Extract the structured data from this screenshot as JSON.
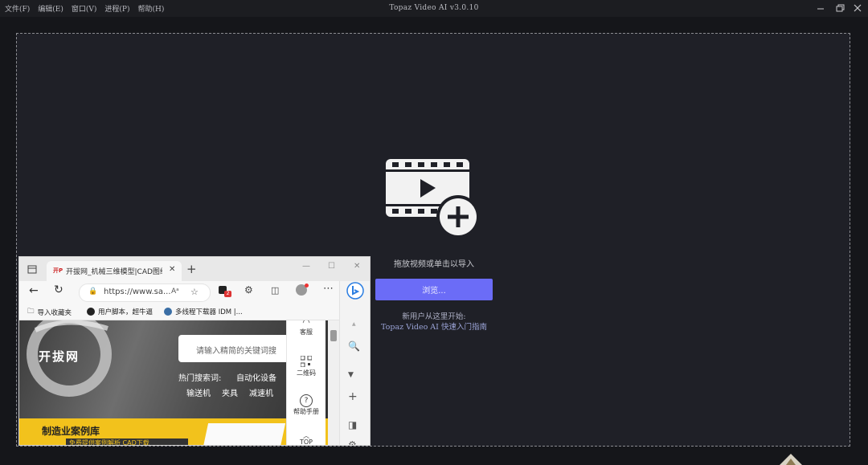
{
  "app": {
    "title": "Topaz Video AI  v3.0.10",
    "menu": [
      "文件(F)",
      "编辑(E)",
      "窗口(V)",
      "进程(P)",
      "帮助(H)"
    ]
  },
  "dropzone": {
    "hint": "拖放视频或单击以导入",
    "browse_label": "浏览...",
    "newuser_line1": "新用户从这里开始:",
    "newuser_line2": "Topaz Video AI 快速入门指南"
  },
  "browser": {
    "tab_title": "开拔网_机械三维模型|CAD图纸|",
    "address": "https://www.sa...",
    "favorites": [
      "导入收藏夹",
      "用户脚本，超牛逼",
      "多线程下载器 IDM |..."
    ],
    "badge_count": "2",
    "content": {
      "logo": "开拔网",
      "search_placeholder": "请输入精简的关键词搜",
      "hot_label": "热门搜索词:",
      "hot_first": "自动化设备",
      "hot_row2": [
        "输送机",
        "夹具",
        "减速机"
      ],
      "case_title": "制造业案例库",
      "case_sub": "免费提供案例解析  CAD下载"
    },
    "float_panel": [
      "客服",
      "二维码",
      "帮助手册",
      "TOP"
    ]
  },
  "colors": {
    "accent": "#6b6cf7",
    "background": "#15161a",
    "dropzone": "#1f2027"
  }
}
